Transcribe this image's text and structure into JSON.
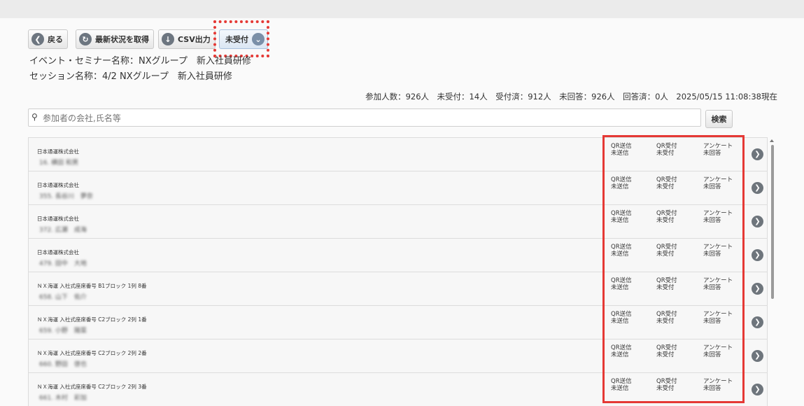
{
  "toolbar": {
    "back_label": "戻る",
    "refresh_label": "最新状況を取得",
    "csv_label": "CSV出力",
    "status_filter_label": "未受付"
  },
  "event": {
    "seminar_line": "イベント・セミナー名称：NXグループ　新入社員研修",
    "session_line": "セッション名称：4/2 NXグループ　新入社員研修"
  },
  "summary": "参加人数：926人　未受付：14人　受付済：912人　未回答：926人　回答済：0人　2025/05/15 11:08:38現在",
  "search": {
    "placeholder": "参加者の会社,氏名等",
    "button_label": "検索"
  },
  "rows": [
    {
      "company": "日本通運株式会社",
      "person": "16. 横田 和男",
      "qr_label": "QR送信",
      "qr_status": "未送信",
      "rec_label": "QR受付",
      "rec_status": "未受付",
      "ank_label": "アンケート",
      "ank_status": "未回答"
    },
    {
      "company": "日本通運株式会社",
      "person": "355. 長谷川　夢奈",
      "qr_label": "QR送信",
      "qr_status": "未送信",
      "rec_label": "QR受付",
      "rec_status": "未受付",
      "ank_label": "アンケート",
      "ank_status": "未回答"
    },
    {
      "company": "日本通運株式会社",
      "person": "372. 広瀬　成海",
      "qr_label": "QR送信",
      "qr_status": "未送信",
      "rec_label": "QR受付",
      "rec_status": "未受付",
      "ank_label": "アンケート",
      "ank_status": "未回答"
    },
    {
      "company": "日本通運株式会社",
      "person": "479. 田中　大地",
      "qr_label": "QR送信",
      "qr_status": "未送信",
      "rec_label": "QR受付",
      "rec_status": "未受付",
      "ank_label": "アンケート",
      "ank_status": "未回答"
    },
    {
      "company": "ＮＸ海運 入社式座席番号 B1ブロック 1列 8番",
      "person": "658. 山下　佑介",
      "qr_label": "QR送信",
      "qr_status": "未送信",
      "rec_label": "QR受付",
      "rec_status": "未受付",
      "ank_label": "アンケート",
      "ank_status": "未回答"
    },
    {
      "company": "ＮＸ海運 入社式座席番号 C2ブロック 2列 1番",
      "person": "659. 小野　陽菜",
      "qr_label": "QR送信",
      "qr_status": "未送信",
      "rec_label": "QR受付",
      "rec_status": "未受付",
      "ank_label": "アンケート",
      "ank_status": "未回答"
    },
    {
      "company": "ＮＸ海運 入社式座席番号 C2ブロック 2列 2番",
      "person": "660. 野田　啓也",
      "qr_label": "QR送信",
      "qr_status": "未送信",
      "rec_label": "QR受付",
      "rec_status": "未受付",
      "ank_label": "アンケート",
      "ank_status": "未回答"
    },
    {
      "company": "ＮＸ海運 入社式座席番号 C2ブロック 2列 3番",
      "person": "661. 木村　彩加",
      "qr_label": "QR送信",
      "qr_status": "未送信",
      "rec_label": "QR受付",
      "rec_status": "未受付",
      "ank_label": "アンケート",
      "ank_status": "未回答"
    }
  ],
  "icons": {
    "back": "arrow-left-icon",
    "refresh": "refresh-icon",
    "csv": "download-icon",
    "status": "chevron-down-icon",
    "search": "search-icon",
    "row": "chevron-right-icon"
  },
  "colors": {
    "highlight": "#e53935",
    "icon": "#6d7680"
  }
}
